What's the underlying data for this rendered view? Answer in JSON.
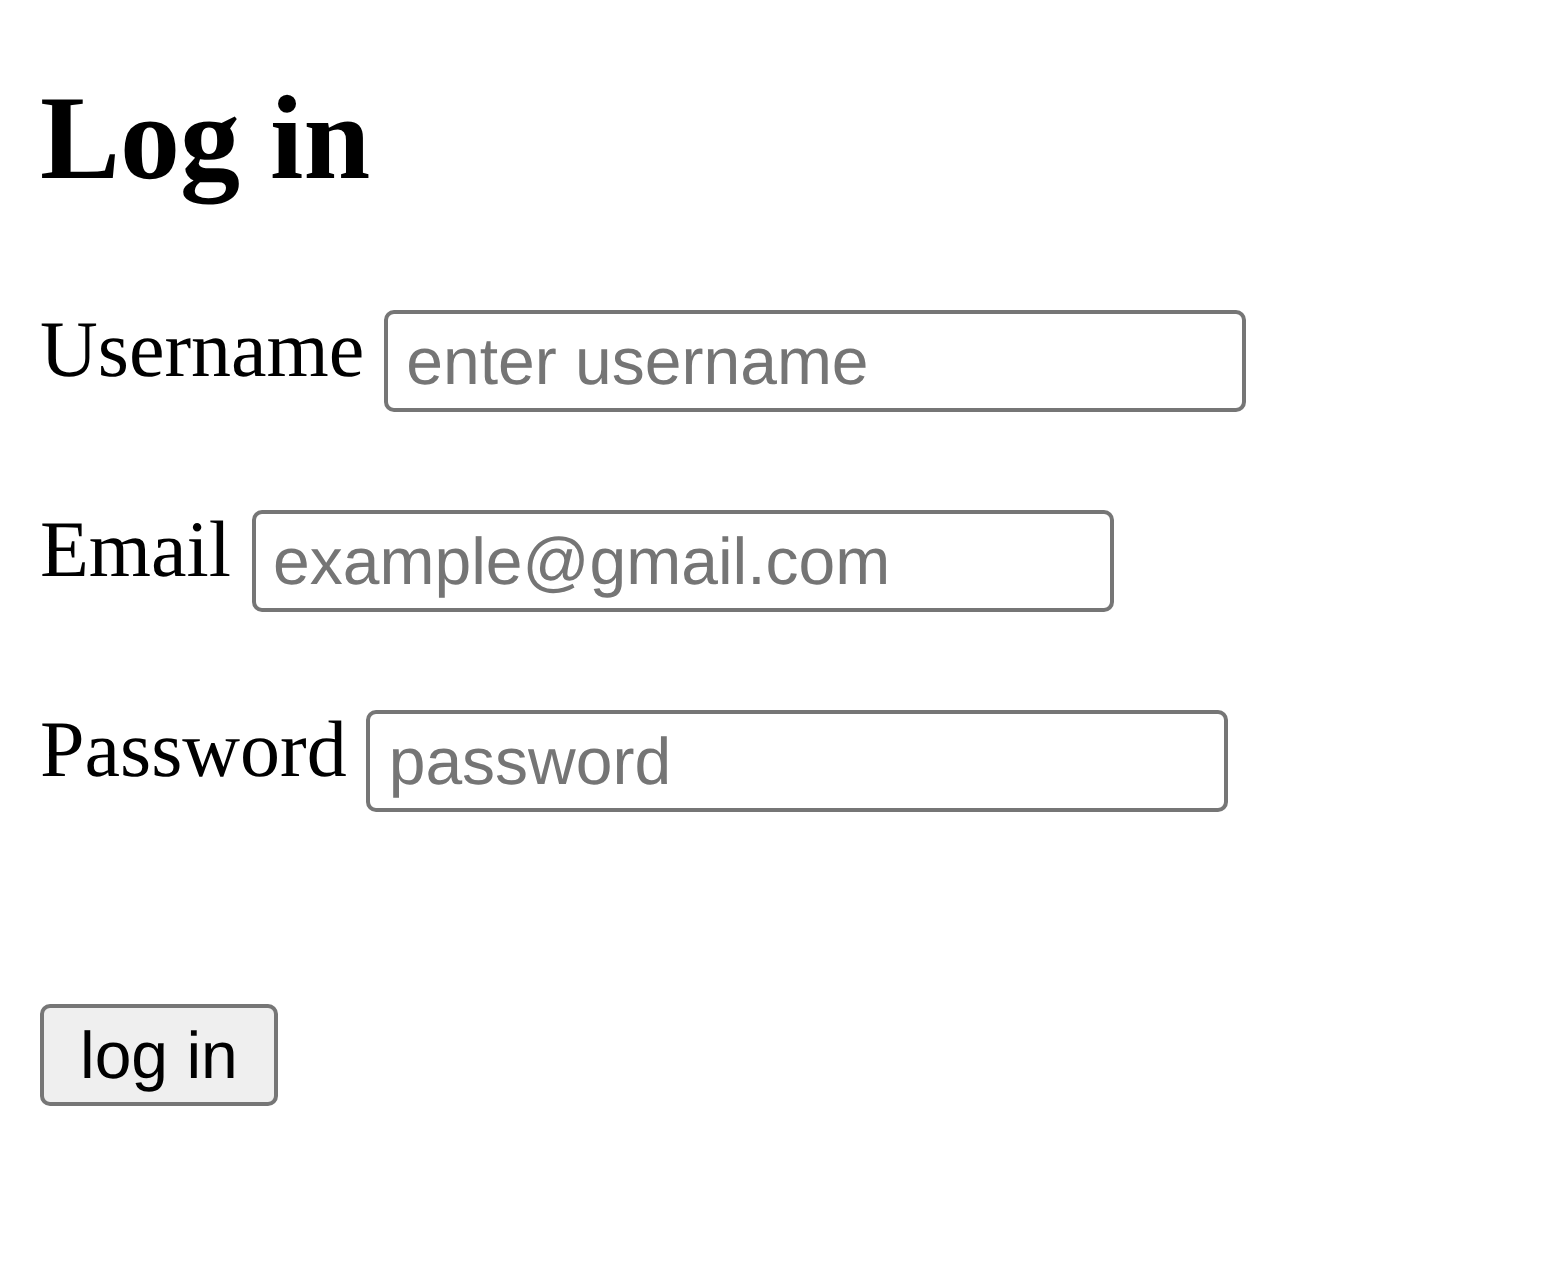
{
  "heading": "Log in",
  "fields": [
    {
      "label": "Username",
      "placeholder": "enter username"
    },
    {
      "label": "Email",
      "placeholder": "example@gmail.com"
    },
    {
      "label": "Password",
      "placeholder": "password"
    }
  ],
  "submit_button": "log in"
}
